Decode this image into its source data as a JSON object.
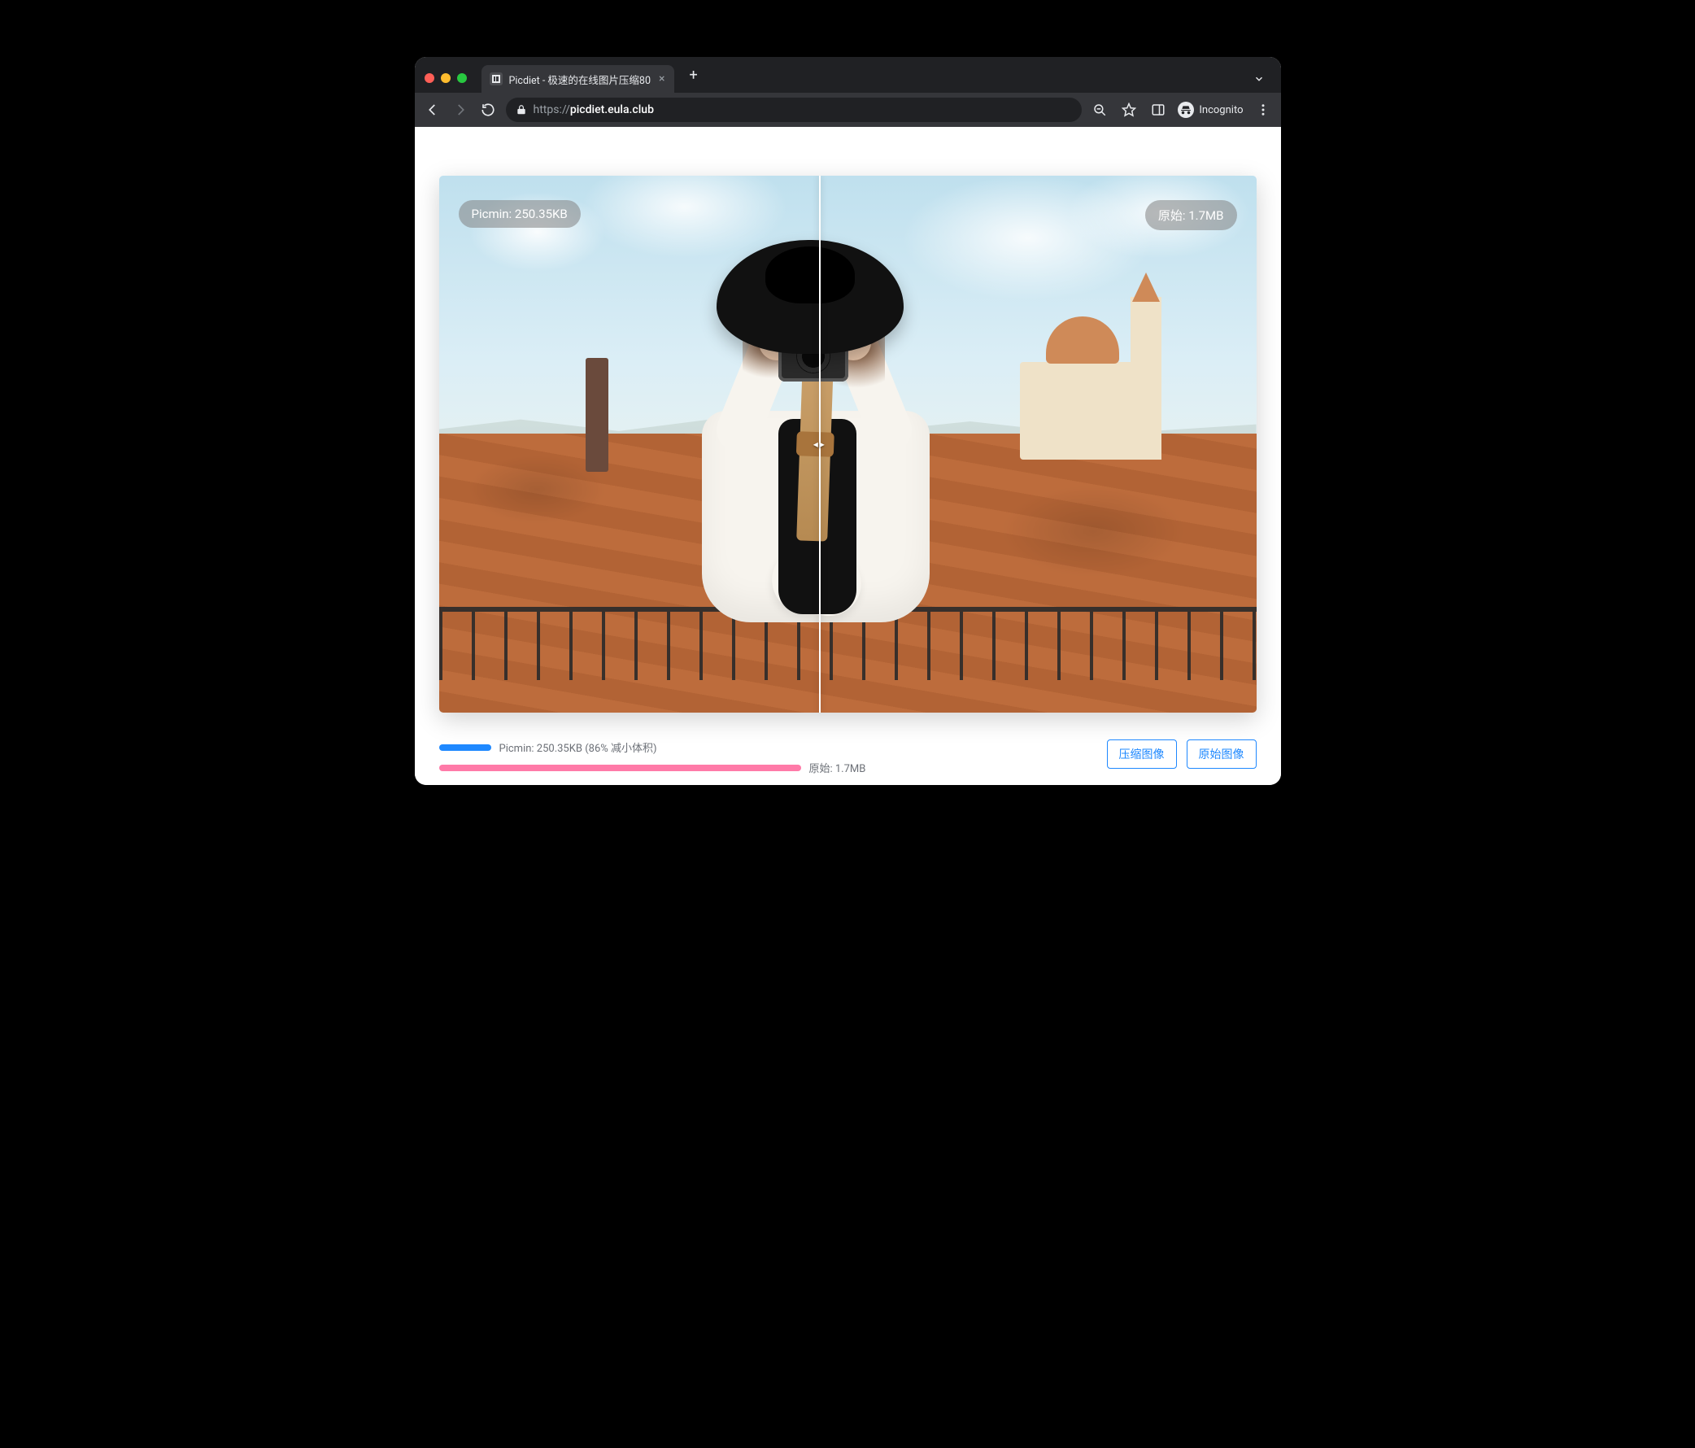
{
  "browser": {
    "tab_title": "Picdiet - 极速的在线图片压缩80",
    "incognito_label": "Incognito",
    "url_scheme": "https://",
    "url_host": "picdiet.eula.club",
    "url_path": ""
  },
  "compare": {
    "left_badge": "Picmin: 250.35KB",
    "right_badge": "原始: 1.7MB",
    "split_percent": 46.5
  },
  "stats": {
    "compressed_line": "Picmin: 250.35KB (86% 减小体积)",
    "original_line": "原始: 1.7MB",
    "compressed_bar_percent": 14,
    "original_bar_percent": 100
  },
  "actions": {
    "compress_label": "压缩图像",
    "original_label": "原始图像"
  },
  "colors": {
    "accent_blue": "#1e88ff",
    "accent_pink": "#ff7aa8"
  }
}
